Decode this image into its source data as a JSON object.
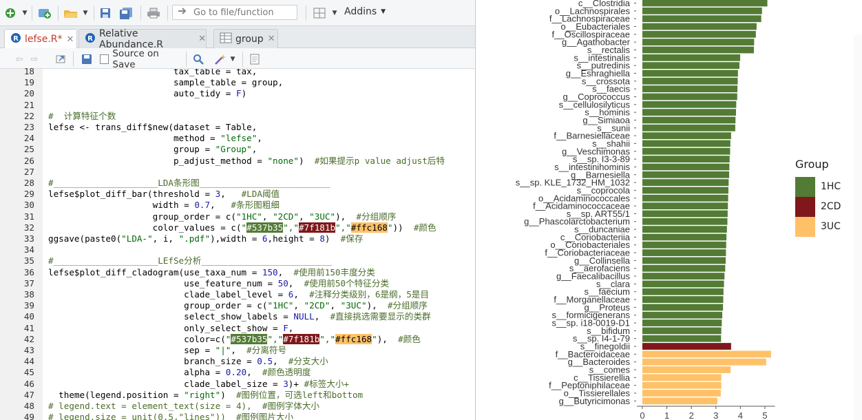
{
  "toolbar": {
    "goto_placeholder": "Go to file/function",
    "addins_label": "Addins"
  },
  "tabs": [
    {
      "label": "lefse.R*",
      "active": true
    },
    {
      "label": "Relative Abundance.R",
      "active": false
    },
    {
      "label": "group",
      "active": false
    }
  ],
  "editor_toolbar": {
    "source_on_save_label": "Source on Save"
  },
  "code_lines": [
    {
      "num": "18",
      "segments": [
        {
          "t": "                        tax_table = tax,",
          "c": ""
        }
      ]
    },
    {
      "num": "19",
      "segments": [
        {
          "t": "                        sample_table = group,",
          "c": ""
        }
      ]
    },
    {
      "num": "20",
      "segments": [
        {
          "t": "                        auto_tidy = ",
          "c": ""
        },
        {
          "t": "F",
          "c": "nm"
        },
        {
          "t": ")",
          "c": ""
        }
      ]
    },
    {
      "num": "21",
      "segments": [
        {
          "t": "",
          "c": ""
        }
      ]
    },
    {
      "num": "22",
      "segments": [
        {
          "t": "#  计算特征个数",
          "c": "cm"
        }
      ]
    },
    {
      "num": "23",
      "segments": [
        {
          "t": "lefse <- trans_diff$new(dataset = Table,",
          "c": ""
        }
      ]
    },
    {
      "num": "24",
      "segments": [
        {
          "t": "                        method = ",
          "c": ""
        },
        {
          "t": "\"lefse\"",
          "c": "st"
        },
        {
          "t": ",",
          "c": ""
        }
      ]
    },
    {
      "num": "25",
      "segments": [
        {
          "t": "                        group = ",
          "c": ""
        },
        {
          "t": "\"Group\"",
          "c": "st"
        },
        {
          "t": ",",
          "c": ""
        }
      ]
    },
    {
      "num": "26",
      "segments": [
        {
          "t": "                        p_adjust_method = ",
          "c": ""
        },
        {
          "t": "\"none\"",
          "c": "st"
        },
        {
          "t": ")  ",
          "c": ""
        },
        {
          "t": "#如果提示p value adjust后特",
          "c": "cm"
        }
      ]
    },
    {
      "num": "27",
      "segments": [
        {
          "t": "",
          "c": ""
        }
      ]
    },
    {
      "num": "28",
      "segments": [
        {
          "t": "#____________________LDA条形图_________________________",
          "c": "cm"
        }
      ]
    },
    {
      "num": "29",
      "segments": [
        {
          "t": "lefse$plot_diff_bar(threshold = ",
          "c": ""
        },
        {
          "t": "3",
          "c": "nm"
        },
        {
          "t": ",   ",
          "c": ""
        },
        {
          "t": "#LDA阈值",
          "c": "cm"
        }
      ]
    },
    {
      "num": "30",
      "segments": [
        {
          "t": "                    width = ",
          "c": ""
        },
        {
          "t": "0.7",
          "c": "nm"
        },
        {
          "t": ",   ",
          "c": ""
        },
        {
          "t": "#条形图粗细",
          "c": "cm"
        }
      ]
    },
    {
      "num": "31",
      "segments": [
        {
          "t": "                    group_order = c(",
          "c": ""
        },
        {
          "t": "\"1HC\"",
          "c": "st"
        },
        {
          "t": ", ",
          "c": ""
        },
        {
          "t": "\"2CD\"",
          "c": "st"
        },
        {
          "t": ", ",
          "c": ""
        },
        {
          "t": "\"3UC\"",
          "c": "st"
        },
        {
          "t": "),  ",
          "c": ""
        },
        {
          "t": "#分组顺序",
          "c": "cm"
        }
      ]
    },
    {
      "num": "32",
      "segments": [
        {
          "t": "                    color_values = c(",
          "c": ""
        },
        {
          "t": "\"",
          "c": "st"
        },
        {
          "t": "#537b35",
          "c": "hl1"
        },
        {
          "t": "\",\"",
          "c": "st"
        },
        {
          "t": "#7f181b",
          "c": "hl2"
        },
        {
          "t": "\",\"",
          "c": "st"
        },
        {
          "t": "#ffc168",
          "c": "hl3"
        },
        {
          "t": "\"",
          "c": "st"
        },
        {
          "t": "))  ",
          "c": ""
        },
        {
          "t": "#颜色",
          "c": "cm"
        }
      ]
    },
    {
      "num": "33",
      "segments": [
        {
          "t": "ggsave(paste0(",
          "c": ""
        },
        {
          "t": "\"LDA-\"",
          "c": "st"
        },
        {
          "t": ", i, ",
          "c": ""
        },
        {
          "t": "\".pdf\"",
          "c": "st"
        },
        {
          "t": "),width = ",
          "c": ""
        },
        {
          "t": "6",
          "c": "nm"
        },
        {
          "t": ",height = ",
          "c": ""
        },
        {
          "t": "8",
          "c": "nm"
        },
        {
          "t": ")  ",
          "c": ""
        },
        {
          "t": "#保存",
          "c": "cm"
        }
      ]
    },
    {
      "num": "34",
      "segments": [
        {
          "t": "",
          "c": ""
        }
      ]
    },
    {
      "num": "35",
      "segments": [
        {
          "t": "#____________________LEfSe分析_________________________",
          "c": "cm"
        }
      ]
    },
    {
      "num": "36",
      "segments": [
        {
          "t": "lefse$plot_diff_cladogram(use_taxa_num = ",
          "c": ""
        },
        {
          "t": "150",
          "c": "nm"
        },
        {
          "t": ",  ",
          "c": ""
        },
        {
          "t": "#使用前150丰度分类",
          "c": "cm"
        }
      ]
    },
    {
      "num": "37",
      "segments": [
        {
          "t": "                          use_feature_num = ",
          "c": ""
        },
        {
          "t": "50",
          "c": "nm"
        },
        {
          "t": ",  ",
          "c": ""
        },
        {
          "t": "#使用前50个特征分类",
          "c": "cm"
        }
      ]
    },
    {
      "num": "38",
      "segments": [
        {
          "t": "                          clade_label_level = ",
          "c": ""
        },
        {
          "t": "6",
          "c": "nm"
        },
        {
          "t": ",  ",
          "c": ""
        },
        {
          "t": "#注释分类级别，6是纲，5是目",
          "c": "cm"
        }
      ]
    },
    {
      "num": "39",
      "segments": [
        {
          "t": "                          group_order = c(",
          "c": ""
        },
        {
          "t": "\"1HC\"",
          "c": "st"
        },
        {
          "t": ", ",
          "c": ""
        },
        {
          "t": "\"2CD\"",
          "c": "st"
        },
        {
          "t": ", ",
          "c": ""
        },
        {
          "t": "\"3UC\"",
          "c": "st"
        },
        {
          "t": "),  ",
          "c": ""
        },
        {
          "t": "#分组顺序",
          "c": "cm"
        }
      ]
    },
    {
      "num": "40",
      "segments": [
        {
          "t": "                          select_show_labels = ",
          "c": ""
        },
        {
          "t": "NULL",
          "c": "nm"
        },
        {
          "t": ",  ",
          "c": ""
        },
        {
          "t": "#直接挑选需要显示的类群",
          "c": "cm"
        }
      ]
    },
    {
      "num": "41",
      "segments": [
        {
          "t": "                          only_select_show = ",
          "c": ""
        },
        {
          "t": "F",
          "c": "nm"
        },
        {
          "t": ",",
          "c": ""
        }
      ]
    },
    {
      "num": "42",
      "segments": [
        {
          "t": "                          color=c(",
          "c": ""
        },
        {
          "t": "\"",
          "c": "st"
        },
        {
          "t": "#537b35",
          "c": "hl1"
        },
        {
          "t": "\",\"",
          "c": "st"
        },
        {
          "t": "#7f181b",
          "c": "hl2"
        },
        {
          "t": "\",\"",
          "c": "st"
        },
        {
          "t": "#ffc168",
          "c": "hl3"
        },
        {
          "t": "\"",
          "c": "st"
        },
        {
          "t": "),  ",
          "c": ""
        },
        {
          "t": "#颜色",
          "c": "cm"
        }
      ]
    },
    {
      "num": "43",
      "segments": [
        {
          "t": "                          sep = ",
          "c": ""
        },
        {
          "t": "\"|\"",
          "c": "st"
        },
        {
          "t": ",  ",
          "c": ""
        },
        {
          "t": "#分离符号",
          "c": "cm"
        }
      ]
    },
    {
      "num": "44",
      "segments": [
        {
          "t": "                          branch_size = ",
          "c": ""
        },
        {
          "t": "0.5",
          "c": "nm"
        },
        {
          "t": ",  ",
          "c": ""
        },
        {
          "t": "#分支大小",
          "c": "cm"
        }
      ]
    },
    {
      "num": "45",
      "segments": [
        {
          "t": "                          alpha = ",
          "c": ""
        },
        {
          "t": "0.20",
          "c": "nm"
        },
        {
          "t": ",  ",
          "c": ""
        },
        {
          "t": "#颜色透明度",
          "c": "cm"
        }
      ]
    },
    {
      "num": "46",
      "segments": [
        {
          "t": "                          clade_label_size = ",
          "c": ""
        },
        {
          "t": "3",
          "c": "nm"
        },
        {
          "t": ")+ ",
          "c": ""
        },
        {
          "t": "#标签大小+",
          "c": "cm"
        }
      ]
    },
    {
      "num": "47",
      "segments": [
        {
          "t": "  theme(legend.position = ",
          "c": ""
        },
        {
          "t": "\"right\"",
          "c": "st"
        },
        {
          "t": ")  ",
          "c": ""
        },
        {
          "t": "#图例位置，可选left和bottom",
          "c": "cm"
        }
      ]
    },
    {
      "num": "48",
      "segments": [
        {
          "t": "# legend.text = element_text(size = 4),  #图例字体大小",
          "c": "cm"
        }
      ]
    },
    {
      "num": "49",
      "segments": [
        {
          "t": "# legend.size = unit(0.5,\"lines\"))  #图例图片大小",
          "c": "cm"
        }
      ]
    }
  ],
  "chart_data": {
    "type": "bar",
    "orientation": "horizontal",
    "xlim": [
      0,
      5.3
    ],
    "xticks": [
      "0",
      "1",
      "2",
      "3",
      "4",
      "5"
    ],
    "legend": {
      "title": "Group",
      "position": "right",
      "entries": [
        {
          "label": "1HC",
          "color": "#537b35"
        },
        {
          "label": "2CD",
          "color": "#7f181b"
        },
        {
          "label": "3UC",
          "color": "#ffc168"
        }
      ]
    },
    "bars": [
      {
        "label": "c__Clostridia",
        "value": 5.1,
        "group": "1HC"
      },
      {
        "label": "o__Lachnospirales",
        "value": 4.88,
        "group": "1HC"
      },
      {
        "label": "f__Lachnospiraceae",
        "value": 4.85,
        "group": "1HC"
      },
      {
        "label": "o__Eubacteriales",
        "value": 4.66,
        "group": "1HC"
      },
      {
        "label": "f__Oscillospiraceae",
        "value": 4.63,
        "group": "1HC"
      },
      {
        "label": "g__Agathobacter",
        "value": 4.56,
        "group": "1HC"
      },
      {
        "label": "s__rectalis",
        "value": 4.55,
        "group": "1HC"
      },
      {
        "label": "s__intestinalis",
        "value": 3.99,
        "group": "1HC"
      },
      {
        "label": "s__putredinis",
        "value": 3.96,
        "group": "1HC"
      },
      {
        "label": "g__Eshraghiella",
        "value": 3.9,
        "group": "1HC"
      },
      {
        "label": "s__crossota",
        "value": 3.89,
        "group": "1HC"
      },
      {
        "label": "s__faecis",
        "value": 3.88,
        "group": "1HC"
      },
      {
        "label": "g__Coprococcus",
        "value": 3.87,
        "group": "1HC"
      },
      {
        "label": "s__cellulosilyticus",
        "value": 3.83,
        "group": "1HC"
      },
      {
        "label": "s__hominis",
        "value": 3.82,
        "group": "1HC"
      },
      {
        "label": "g__Simiaoa",
        "value": 3.8,
        "group": "1HC"
      },
      {
        "label": "s__sunii",
        "value": 3.79,
        "group": "1HC"
      },
      {
        "label": "f__Barnesiellaceae",
        "value": 3.62,
        "group": "1HC"
      },
      {
        "label": "s__shahii",
        "value": 3.59,
        "group": "1HC"
      },
      {
        "label": "g__Veschimonas",
        "value": 3.58,
        "group": "1HC"
      },
      {
        "label": "s__sp. I3-3-89",
        "value": 3.56,
        "group": "1HC"
      },
      {
        "label": "s__intestinihominis",
        "value": 3.55,
        "group": "1HC"
      },
      {
        "label": "g__Barnesiella",
        "value": 3.54,
        "group": "1HC"
      },
      {
        "label": "s__sp. KLE_1732_HM_1032",
        "value": 3.52,
        "group": "1HC"
      },
      {
        "label": "s__coprocola",
        "value": 3.51,
        "group": "1HC"
      },
      {
        "label": "o__Acidaminococcales",
        "value": 3.5,
        "group": "1HC"
      },
      {
        "label": "f__Acidaminococcaceae",
        "value": 3.49,
        "group": "1HC"
      },
      {
        "label": "s__sp. ART55/1",
        "value": 3.48,
        "group": "1HC"
      },
      {
        "label": "g__Phascolarctobacterium",
        "value": 3.47,
        "group": "1HC"
      },
      {
        "label": "s__duncaniae",
        "value": 3.45,
        "group": "1HC"
      },
      {
        "label": "c__Coriobacteriia",
        "value": 3.43,
        "group": "1HC"
      },
      {
        "label": "o__Coriobacteriales",
        "value": 3.42,
        "group": "1HC"
      },
      {
        "label": "f__Coriobacteriaceae",
        "value": 3.41,
        "group": "1HC"
      },
      {
        "label": "g__Collinsella",
        "value": 3.4,
        "group": "1HC"
      },
      {
        "label": "s__aerofaciens",
        "value": 3.38,
        "group": "1HC"
      },
      {
        "label": "g__Faecalibacillus",
        "value": 3.35,
        "group": "1HC"
      },
      {
        "label": "s__clara",
        "value": 3.33,
        "group": "1HC"
      },
      {
        "label": "s__faecium",
        "value": 3.31,
        "group": "1HC"
      },
      {
        "label": "f__Morganellaceae",
        "value": 3.3,
        "group": "1HC"
      },
      {
        "label": "g__Proteus",
        "value": 3.29,
        "group": "1HC"
      },
      {
        "label": "s__formicigenerans",
        "value": 3.26,
        "group": "1HC"
      },
      {
        "label": "s__sp. i18-0019-D1",
        "value": 3.24,
        "group": "1HC"
      },
      {
        "label": "s__bifidum",
        "value": 3.22,
        "group": "1HC"
      },
      {
        "label": "s__sp. I4-1-79",
        "value": 3.21,
        "group": "1HC"
      },
      {
        "label": "s__finegoldii",
        "value": 3.62,
        "group": "2CD"
      },
      {
        "label": "f__Bacteroidaceae",
        "value": 5.25,
        "group": "3UC"
      },
      {
        "label": "g__Bacteroides",
        "value": 5.05,
        "group": "3UC"
      },
      {
        "label": "s__comes",
        "value": 3.6,
        "group": "3UC"
      },
      {
        "label": "c__Tissierellia",
        "value": 3.22,
        "group": "3UC"
      },
      {
        "label": "f__Peptoniphilaceae",
        "value": 3.22,
        "group": "3UC"
      },
      {
        "label": "o__Tissierellales",
        "value": 3.2,
        "group": "3UC"
      },
      {
        "label": "g__Butyricimonas",
        "value": 3.06,
        "group": "3UC"
      }
    ]
  }
}
